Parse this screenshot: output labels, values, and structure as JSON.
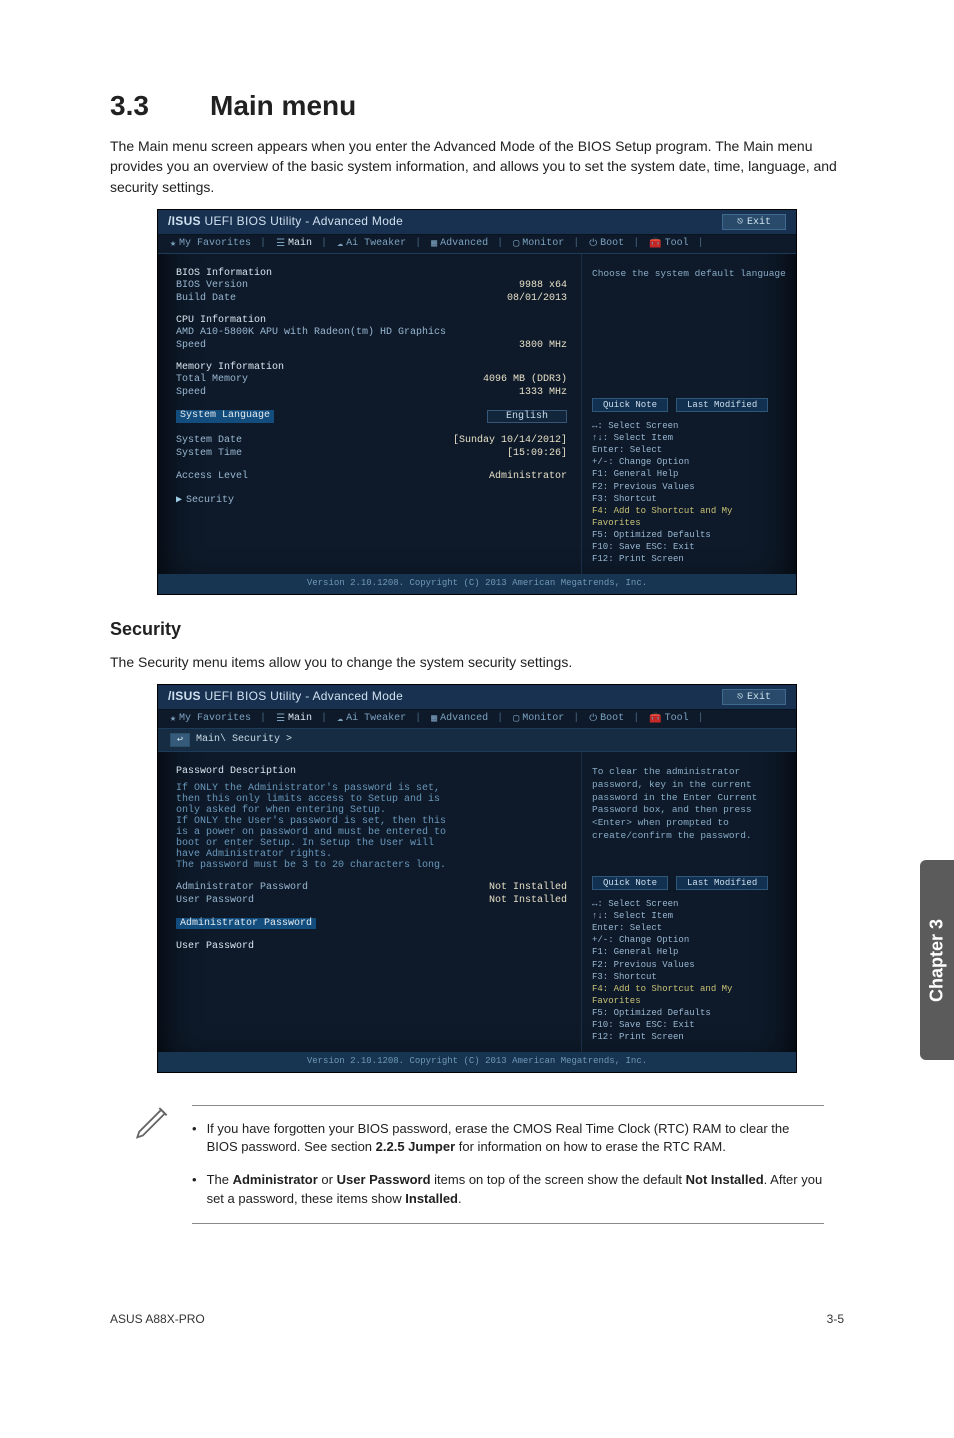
{
  "doc": {
    "sectionNumber": "3.3",
    "title": "Main menu",
    "intro": "The Main menu screen appears when you enter the Advanced Mode of the BIOS Setup program. The Main menu provides you an overview of the basic system information, and allows you to set the system date, time, language, and security settings.",
    "securityHeading": "Security",
    "securityIntro": "The Security menu items allow you to change the system security settings.",
    "notes": [
      {
        "pre": "If you have forgotten your BIOS password, erase the CMOS Real Time Clock (RTC) RAM to clear the BIOS password. See section ",
        "bold1": "2.2.5 Jumper",
        "post": " for information on how to erase the RTC RAM."
      },
      {
        "pre": "The ",
        "bold1": "Administrator",
        "mid1": " or ",
        "bold2": "User Password",
        "mid2": " items on top of the screen show the default ",
        "bold3": "Not Installed",
        "mid3": ". After you set a password, these items show ",
        "bold4": "Installed",
        "post": "."
      }
    ],
    "footerLeft": "ASUS A88X-PRO",
    "footerRight": "3-5",
    "sideTab": "Chapter 3"
  },
  "bios": {
    "brand": "/ISUS",
    "appTitle": "UEFI BIOS Utility - Advanced Mode",
    "exitLabel": "Exit",
    "tabs": [
      "My Favorites",
      "Main",
      "Ai Tweaker",
      "Advanced",
      "Monitor",
      "Boot",
      "Tool"
    ],
    "main": {
      "infoGroups": [
        {
          "title": "BIOS Information",
          "rows": [
            {
              "label": "BIOS Version",
              "value": "9988 x64"
            },
            {
              "label": "Build Date",
              "value": "08/01/2013"
            }
          ]
        },
        {
          "title": "CPU Information",
          "rows": [
            {
              "label": "AMD A10-5800K APU with Radeon(tm) HD Graphics",
              "value": ""
            },
            {
              "label": "Speed",
              "value": "3800 MHz"
            }
          ]
        },
        {
          "title": "Memory Information",
          "rows": [
            {
              "label": "Total Memory",
              "value": "4096 MB (DDR3)"
            },
            {
              "label": "Speed",
              "value": "1333 MHz"
            }
          ]
        }
      ],
      "selected": {
        "label": "System Language",
        "value": "English"
      },
      "dateRow": {
        "label": "System Date",
        "value": "[Sunday 10/14/2012]"
      },
      "timeRow": {
        "label": "System Time",
        "value": "[15:09:26]"
      },
      "accessRow": {
        "label": "Access Level",
        "value": "Administrator"
      },
      "submenu": "Security",
      "helpText": "Choose the system default language"
    },
    "security": {
      "breadcrumb": "Main\\ Security >",
      "descTitle": "Password Description",
      "descLines": [
        "If ONLY the Administrator's password is set,",
        "then this only limits access to Setup and is",
        "only asked for when entering Setup.",
        "If ONLY the User's password is set, then this",
        "is a power on password and must be entered to",
        "boot or enter Setup. In Setup the User will",
        "have Administrator rights.",
        "The password must be 3 to 20 characters long."
      ],
      "rows": [
        {
          "label": "Administrator Password",
          "value": "Not Installed"
        },
        {
          "label": "User Password",
          "value": "Not Installed"
        }
      ],
      "selected": "Administrator Password",
      "item2": "User Password",
      "helpText": "To clear the administrator password, key in the current password in the Enter Current Password box, and then press <Enter> when prompted to create/confirm the password."
    },
    "quickNote": "Quick Note",
    "lastModified": "Last Modified",
    "keyHelp": [
      "↔: Select Screen",
      "↑↓: Select Item",
      "Enter: Select",
      "+/-: Change Option",
      "F1: General Help",
      "F2: Previous Values",
      "F3: Shortcut",
      "F4: Add to Shortcut and My Favorites",
      "F5: Optimized Defaults",
      "F10: Save  ESC: Exit",
      "F12: Print Screen"
    ],
    "copyright": "Version 2.10.1208. Copyright (C) 2013 American Megatrends, Inc."
  }
}
